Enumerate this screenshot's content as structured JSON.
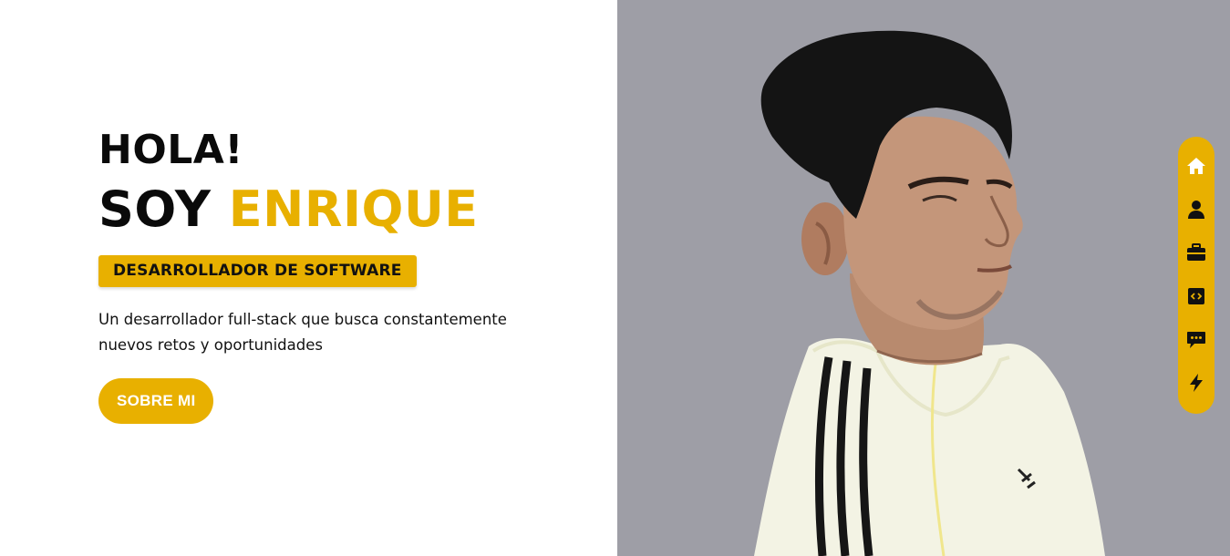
{
  "hero": {
    "greeting": "HOLA!",
    "intro_prefix": "SOY",
    "name": "ENRIQUE",
    "role": "DESARROLLADOR DE SOFTWARE",
    "description": "Un desarrollador full-stack que busca constantemente nuevos retos y oportunidades",
    "cta_label": "SOBRE MI"
  },
  "side_nav": {
    "items": [
      {
        "icon": "home-icon",
        "active": true
      },
      {
        "icon": "user-icon",
        "active": false
      },
      {
        "icon": "briefcase-icon",
        "active": false
      },
      {
        "icon": "code-icon",
        "active": false
      },
      {
        "icon": "chat-icon",
        "active": false
      },
      {
        "icon": "bolt-icon",
        "active": false
      }
    ]
  },
  "colors": {
    "accent": "#e8b000",
    "text": "#0a0a0a",
    "photo_background": "#9e9ea6"
  }
}
